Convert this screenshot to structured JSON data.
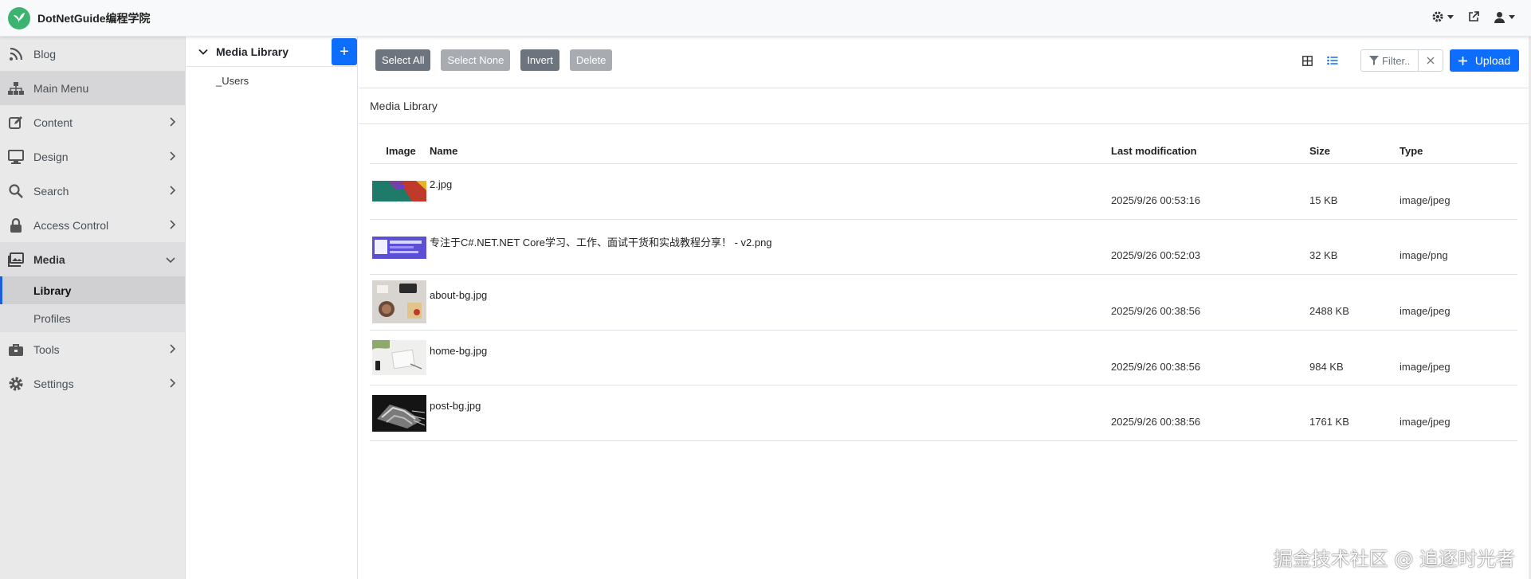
{
  "brand": {
    "title": "DotNetGuide编程学院"
  },
  "sidebar": {
    "items": [
      {
        "label": "Blog",
        "icon": "rss-icon"
      },
      {
        "label": "Main Menu",
        "icon": "sitemap-icon"
      },
      {
        "label": "Content",
        "icon": "edit-icon"
      },
      {
        "label": "Design",
        "icon": "desktop-icon"
      },
      {
        "label": "Search",
        "icon": "search-icon"
      },
      {
        "label": "Access Control",
        "icon": "lock-icon"
      },
      {
        "label": "Media",
        "icon": "images-icon"
      },
      {
        "label": "Tools",
        "icon": "toolbox-icon"
      },
      {
        "label": "Settings",
        "icon": "gear-icon"
      }
    ],
    "media_sub": [
      {
        "label": "Library"
      },
      {
        "label": "Profiles"
      }
    ]
  },
  "tree": {
    "root": "Media Library",
    "children": [
      "_Users"
    ],
    "add_label": "+"
  },
  "toolbar": {
    "select_all": "Select All",
    "select_none": "Select None",
    "invert": "Invert",
    "delete": "Delete",
    "filter_placeholder": "Filter..",
    "upload": "Upload"
  },
  "breadcrumb": "Media Library",
  "table": {
    "headers": {
      "image": "Image",
      "name": "Name",
      "modified": "Last modification",
      "size": "Size",
      "type": "Type"
    },
    "rows": [
      {
        "name": "2.jpg",
        "modified": "2025/9/26 00:53:16",
        "size": "15 KB",
        "type": "image/jpeg"
      },
      {
        "name": "专注于C#.NET.NET Core学习、工作、面试干货和实战教程分享！ - v2.png",
        "modified": "2025/9/26 00:52:03",
        "size": "32 KB",
        "type": "image/png"
      },
      {
        "name": "about-bg.jpg",
        "modified": "2025/9/26 00:38:56",
        "size": "2488 KB",
        "type": "image/jpeg"
      },
      {
        "name": "home-bg.jpg",
        "modified": "2025/9/26 00:38:56",
        "size": "984 KB",
        "type": "image/jpeg"
      },
      {
        "name": "post-bg.jpg",
        "modified": "2025/9/26 00:38:56",
        "size": "1761 KB",
        "type": "image/jpeg"
      }
    ]
  },
  "watermark": "掘金技术社区 @ 追逐时光者",
  "colors": {
    "primary": "#0d6efd",
    "sidebar_bg": "#e9e9ea",
    "button_gray": "#6c757d"
  }
}
